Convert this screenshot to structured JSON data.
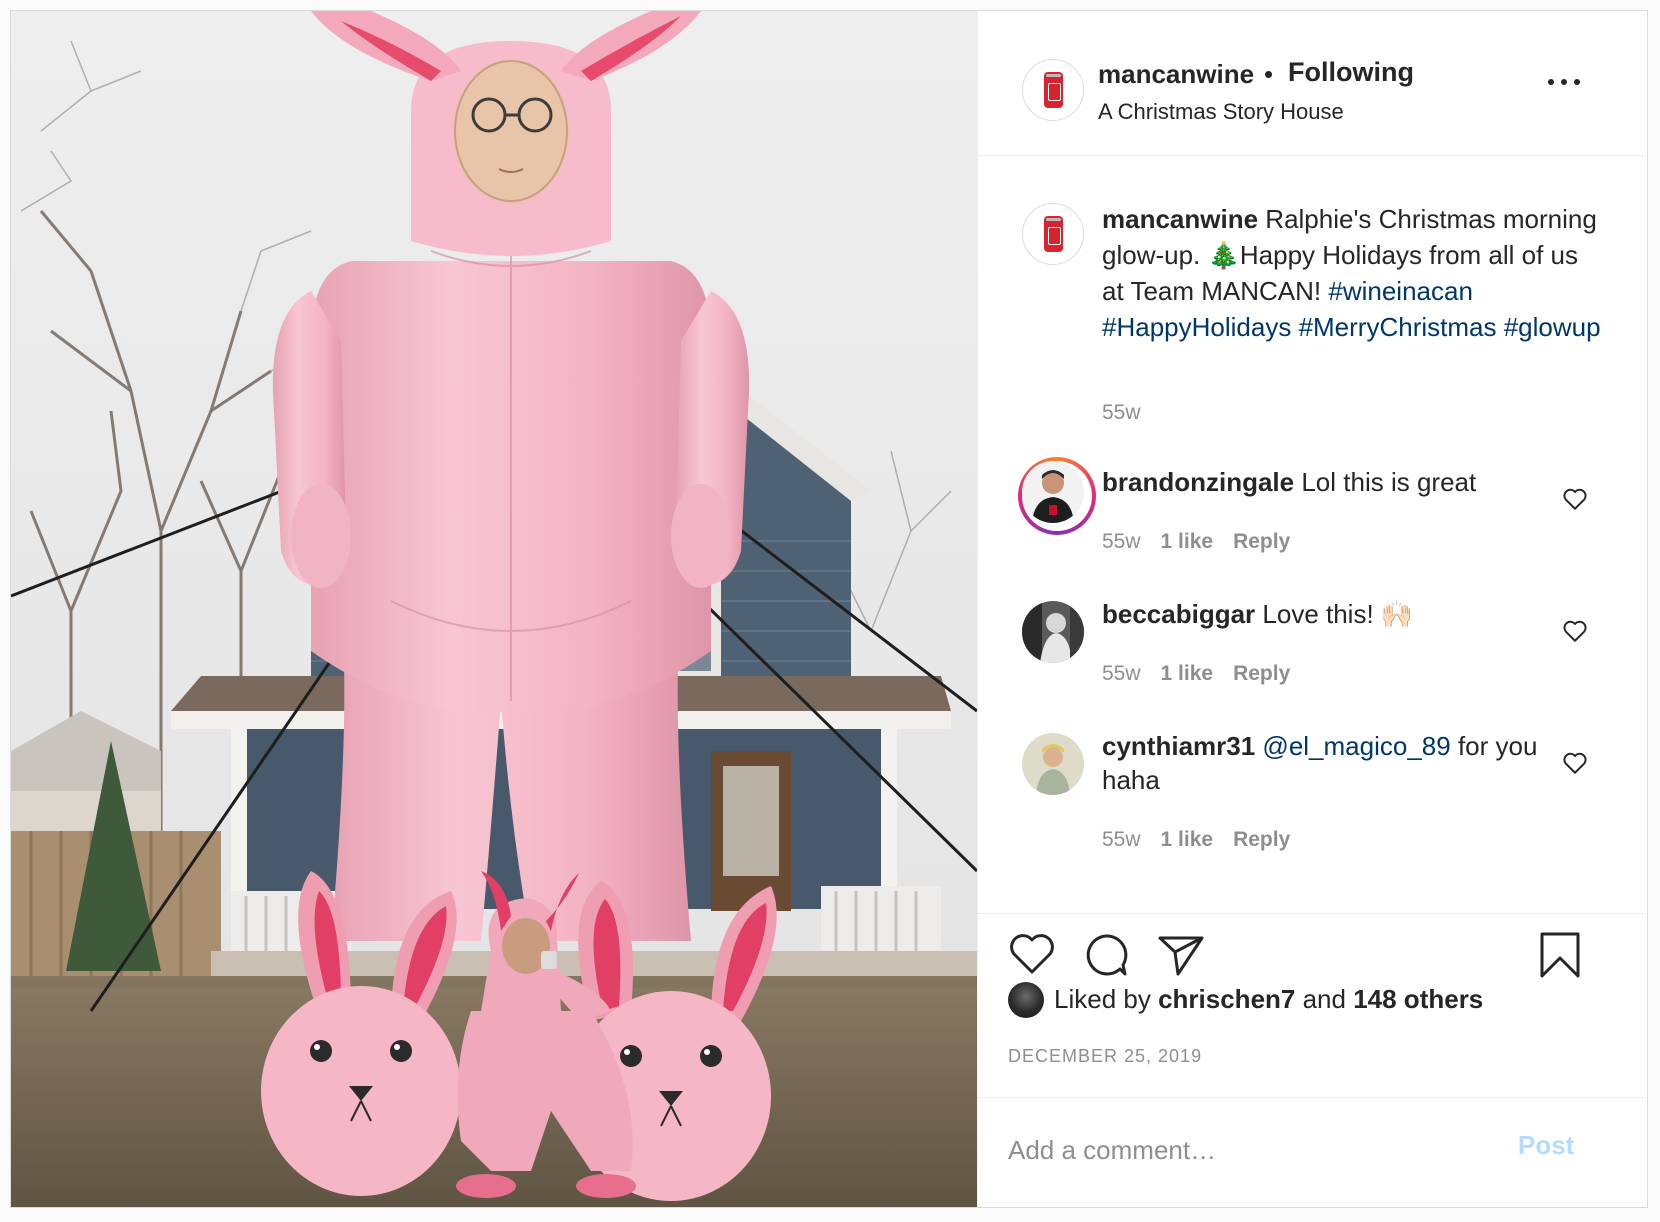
{
  "post": {
    "username": "mancanwine",
    "separator": "•",
    "follow_status": "Following",
    "location": "A Christmas Story House",
    "more_icon": "more-horizontal-icon"
  },
  "caption": {
    "username": "mancanwine",
    "text": " Ralphie's Christmas morning glow-up. 🎄Happy Holidays from all of us at Team MANCAN! ",
    "hashtags": [
      "#wineinacan",
      "#HappyHolidays",
      "#MerryChristmas",
      "#glowup"
    ],
    "time": "55w"
  },
  "comments": [
    {
      "username": "brandonzingale",
      "text": " Lol this is great",
      "time": "55w",
      "likes": "1 like",
      "reply": "Reply"
    },
    {
      "username": "beccabiggar",
      "text": " Love this! 🙌🏻",
      "time": "55w",
      "likes": "1 like",
      "reply": "Reply"
    },
    {
      "username": "cynthiamr31",
      "mention": "@el_magico_89",
      "text": " for you haha",
      "time": "55w",
      "likes": "1 like",
      "reply": "Reply"
    }
  ],
  "actions": {
    "icons": [
      "heart-icon",
      "comment-icon",
      "share-icon",
      "bookmark-icon"
    ],
    "liked_prefix": "Liked by ",
    "liked_user": "chrischen7",
    "liked_mid": " and ",
    "liked_others": "148 others",
    "date": "DECEMBER 25, 2019"
  },
  "comment_box": {
    "placeholder": "Add a comment…",
    "post_label": "Post"
  },
  "colors": {
    "link": "#00376b",
    "muted": "#8e8e8e",
    "post_button_disabled": "#b3dbff",
    "brand_red": "#d8232f",
    "inflatable_pink": "#f4b3c2"
  }
}
